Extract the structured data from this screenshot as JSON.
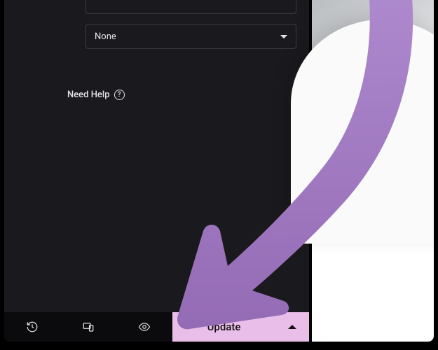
{
  "panel": {
    "top_field_value": "",
    "select_value": "None",
    "help_label": "Need Help"
  },
  "bottom_bar": {
    "update_label": "Update"
  },
  "colors": {
    "accent_arrow": "#9f6fc0",
    "update_bg": "#e9bfe9"
  }
}
